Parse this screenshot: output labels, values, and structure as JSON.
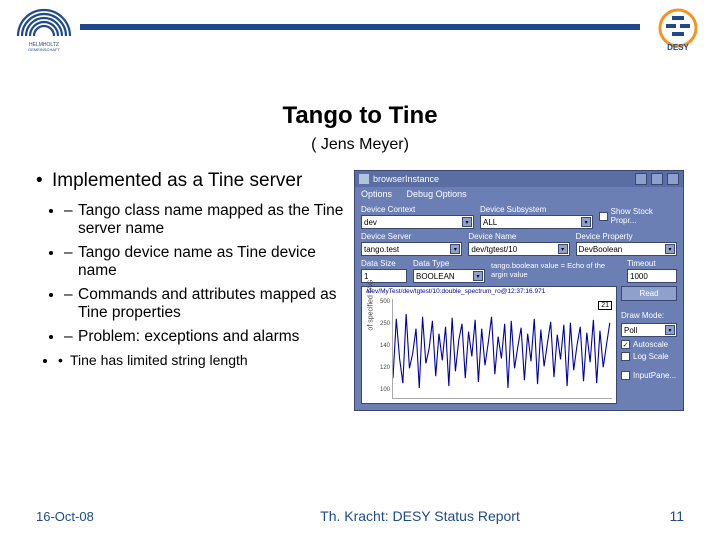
{
  "title": "Tango to Tine",
  "subtitle": "( Jens Meyer)",
  "bullets": {
    "main": "Implemented as a Tine server",
    "subs": [
      "Tango class name mapped as the Tine server name",
      "Tango device name as Tine device name",
      "Commands and attributes mapped as Tine properties",
      "Problem: exceptions and alarms"
    ],
    "subsub": "Tine has limited string length"
  },
  "footer": {
    "date": "16-Oct-08",
    "center": "Th. Kracht: DESY Status Report",
    "page": "11"
  },
  "browser": {
    "window_title": "browserInstance",
    "menu": {
      "options": "Options",
      "debug": "Debug Options"
    },
    "labels": {
      "context": "Device Context",
      "subsystem": "Device Subsystem",
      "server": "Device Server",
      "name": "Device Name",
      "property": "Device Property",
      "size": "Data Size",
      "type": "Data Type",
      "timeout": "Timeout"
    },
    "values": {
      "context": "dev",
      "subsystem": "ALL",
      "server": "tango.test",
      "name": "dev/tgtest/10",
      "property": "DevBoolean",
      "size": "1",
      "type": "BOOLEAN",
      "timeout": "1000"
    },
    "stock_prop": "Show Stock Propr...",
    "status": "tango.boolean value = Echo of the argin value",
    "chart": {
      "title": "/dev/MyTest/dev/tgtest/10:double_spectrum_ro@12:37:16.971",
      "ylabel": "of specified TAG",
      "badge": "21",
      "yticks": [
        "500",
        "250",
        "140",
        "120",
        "100"
      ]
    },
    "side": {
      "read": "Read",
      "drawmode": "Draw Mode:",
      "poll": "Poll",
      "autoscale": "Autoscale",
      "logscale": "Log Scale",
      "inputpanel": "InputPane..."
    }
  },
  "logos": {
    "left_alt": "Helmholtz Gemeinschaft",
    "right_alt": "DESY"
  }
}
